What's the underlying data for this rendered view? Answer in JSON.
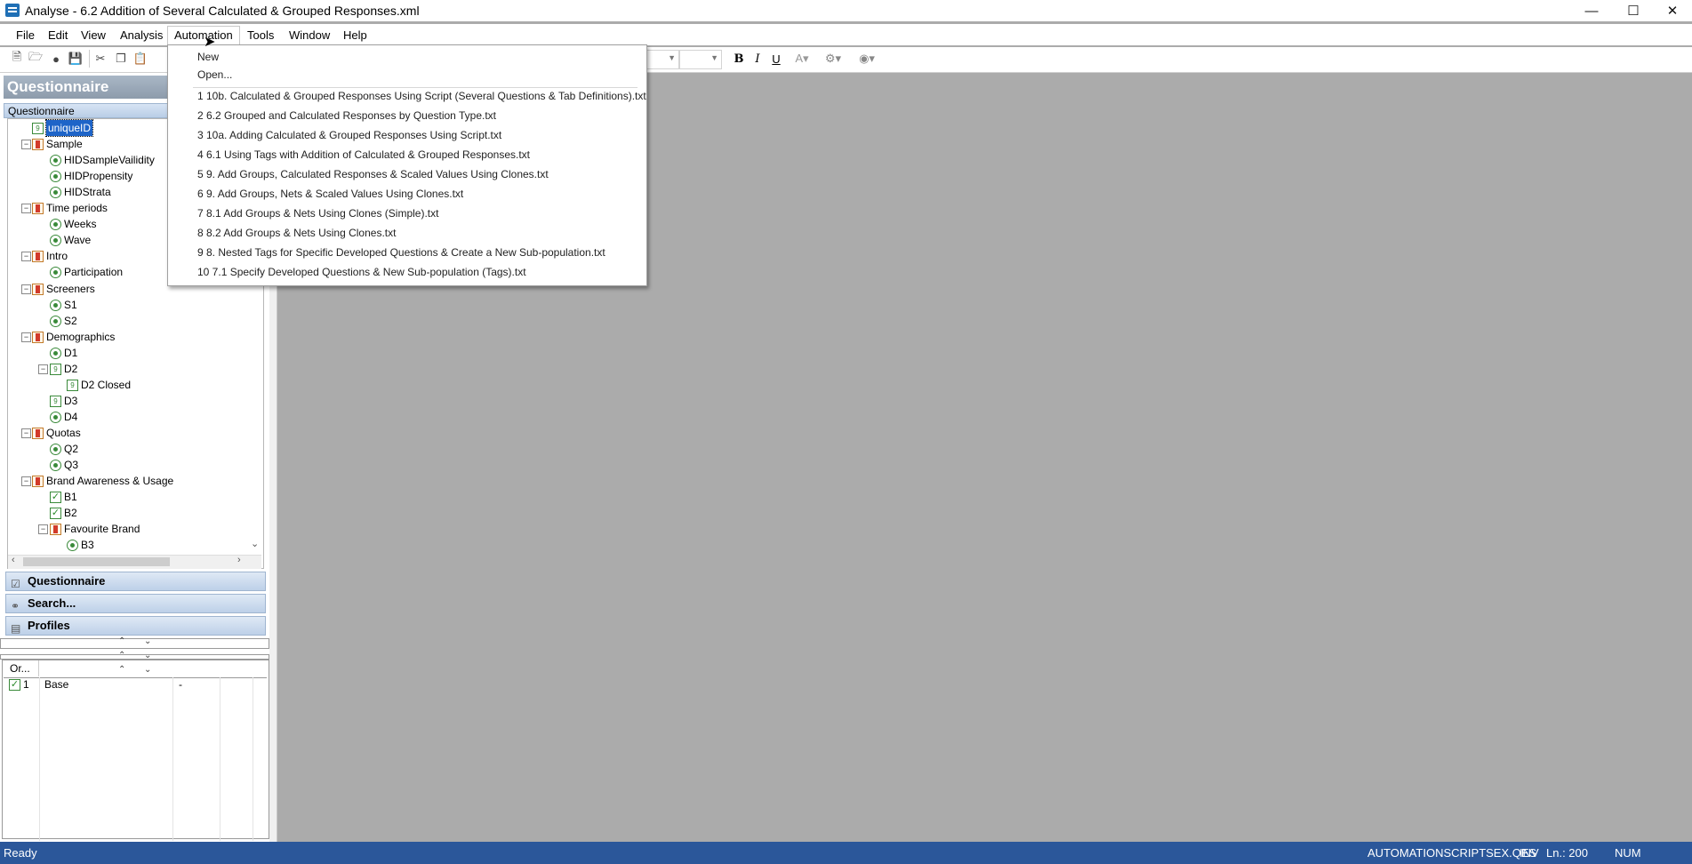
{
  "window": {
    "title": "Analyse - 6.2 Addition of Several Calculated & Grouped Responses.xml"
  },
  "menu": [
    "File",
    "Edit",
    "View",
    "Analysis",
    "Automation",
    "Tools",
    "Window",
    "Help"
  ],
  "automation_menu": {
    "new": "New",
    "open": "Open...",
    "recent": [
      "1 10b. Calculated & Grouped Responses Using Script (Several Questions & Tab Definitions).txt",
      "2 6.2 Grouped and Calculated Responses by Question Type.txt",
      "3 10a. Adding Calculated & Grouped Responses Using Script.txt",
      "4 6.1 Using Tags with Addition of Calculated & Grouped Responses.txt",
      "5 9. Add Groups, Calculated Responses & Scaled Values Using Clones.txt",
      "6 9. Add Groups, Nets & Scaled Values Using Clones.txt",
      "7 8.1 Add Groups & Nets Using Clones (Simple).txt",
      "8 8.2 Add Groups & Nets Using Clones.txt",
      "9 8. Nested Tags for Specific Developed Questions & Create a New Sub-population.txt",
      "10 7.1 Specify Developed Questions & New Sub-population (Tags).txt"
    ]
  },
  "panel": {
    "title": "Questionnaire",
    "tree_header": "Questionnaire",
    "tree": [
      {
        "label": "uniqueID",
        "icon": "number-question-icon",
        "selected": true
      },
      {
        "label": "Sample",
        "icon": "folder-icon"
      },
      {
        "label": "HIDSampleVailidity",
        "icon": "single-choice-icon"
      },
      {
        "label": "HIDPropensity",
        "icon": "single-choice-icon"
      },
      {
        "label": "HIDStrata",
        "icon": "single-choice-icon"
      },
      {
        "label": "Time periods",
        "icon": "folder-icon"
      },
      {
        "label": "Weeks",
        "icon": "single-choice-icon"
      },
      {
        "label": "Wave",
        "icon": "single-choice-icon"
      },
      {
        "label": "Intro",
        "icon": "folder-icon"
      },
      {
        "label": "Participation",
        "icon": "single-choice-icon"
      },
      {
        "label": "Screeners",
        "icon": "folder-icon"
      },
      {
        "label": "S1",
        "icon": "single-choice-icon"
      },
      {
        "label": "S2",
        "icon": "single-choice-icon"
      },
      {
        "label": "Demographics",
        "icon": "folder-icon"
      },
      {
        "label": "D1",
        "icon": "single-choice-icon"
      },
      {
        "label": "D2",
        "icon": "number-question-icon"
      },
      {
        "label": "D2 Closed",
        "icon": "number-question-icon"
      },
      {
        "label": "D3",
        "icon": "number-question-icon"
      },
      {
        "label": "D4",
        "icon": "single-choice-icon"
      },
      {
        "label": "Quotas",
        "icon": "folder-icon"
      },
      {
        "label": "Q2",
        "icon": "single-choice-icon"
      },
      {
        "label": "Q3",
        "icon": "single-choice-icon"
      },
      {
        "label": "Brand Awareness & Usage",
        "icon": "folder-icon"
      },
      {
        "label": "B1",
        "icon": "multi-choice-icon"
      },
      {
        "label": "B2",
        "icon": "multi-choice-icon"
      },
      {
        "label": "Favourite Brand",
        "icon": "folder-icon"
      },
      {
        "label": "B3",
        "icon": "single-choice-icon"
      }
    ],
    "nav": [
      "Questionnaire",
      "Search...",
      "Profiles"
    ],
    "grid": {
      "header": "Or...",
      "row_num": "1",
      "row_label": "Base",
      "row_value": "-"
    }
  },
  "status": {
    "left": "Ready",
    "file": "AUTOMATIONSCRIPTSEX.QES",
    "inv": "INV",
    "ln": "Ln.: 200",
    "num": "NUM"
  },
  "colors": {
    "statusbar": "#2b579a",
    "workspace": "#ababab",
    "selection": "#1e64c8"
  }
}
